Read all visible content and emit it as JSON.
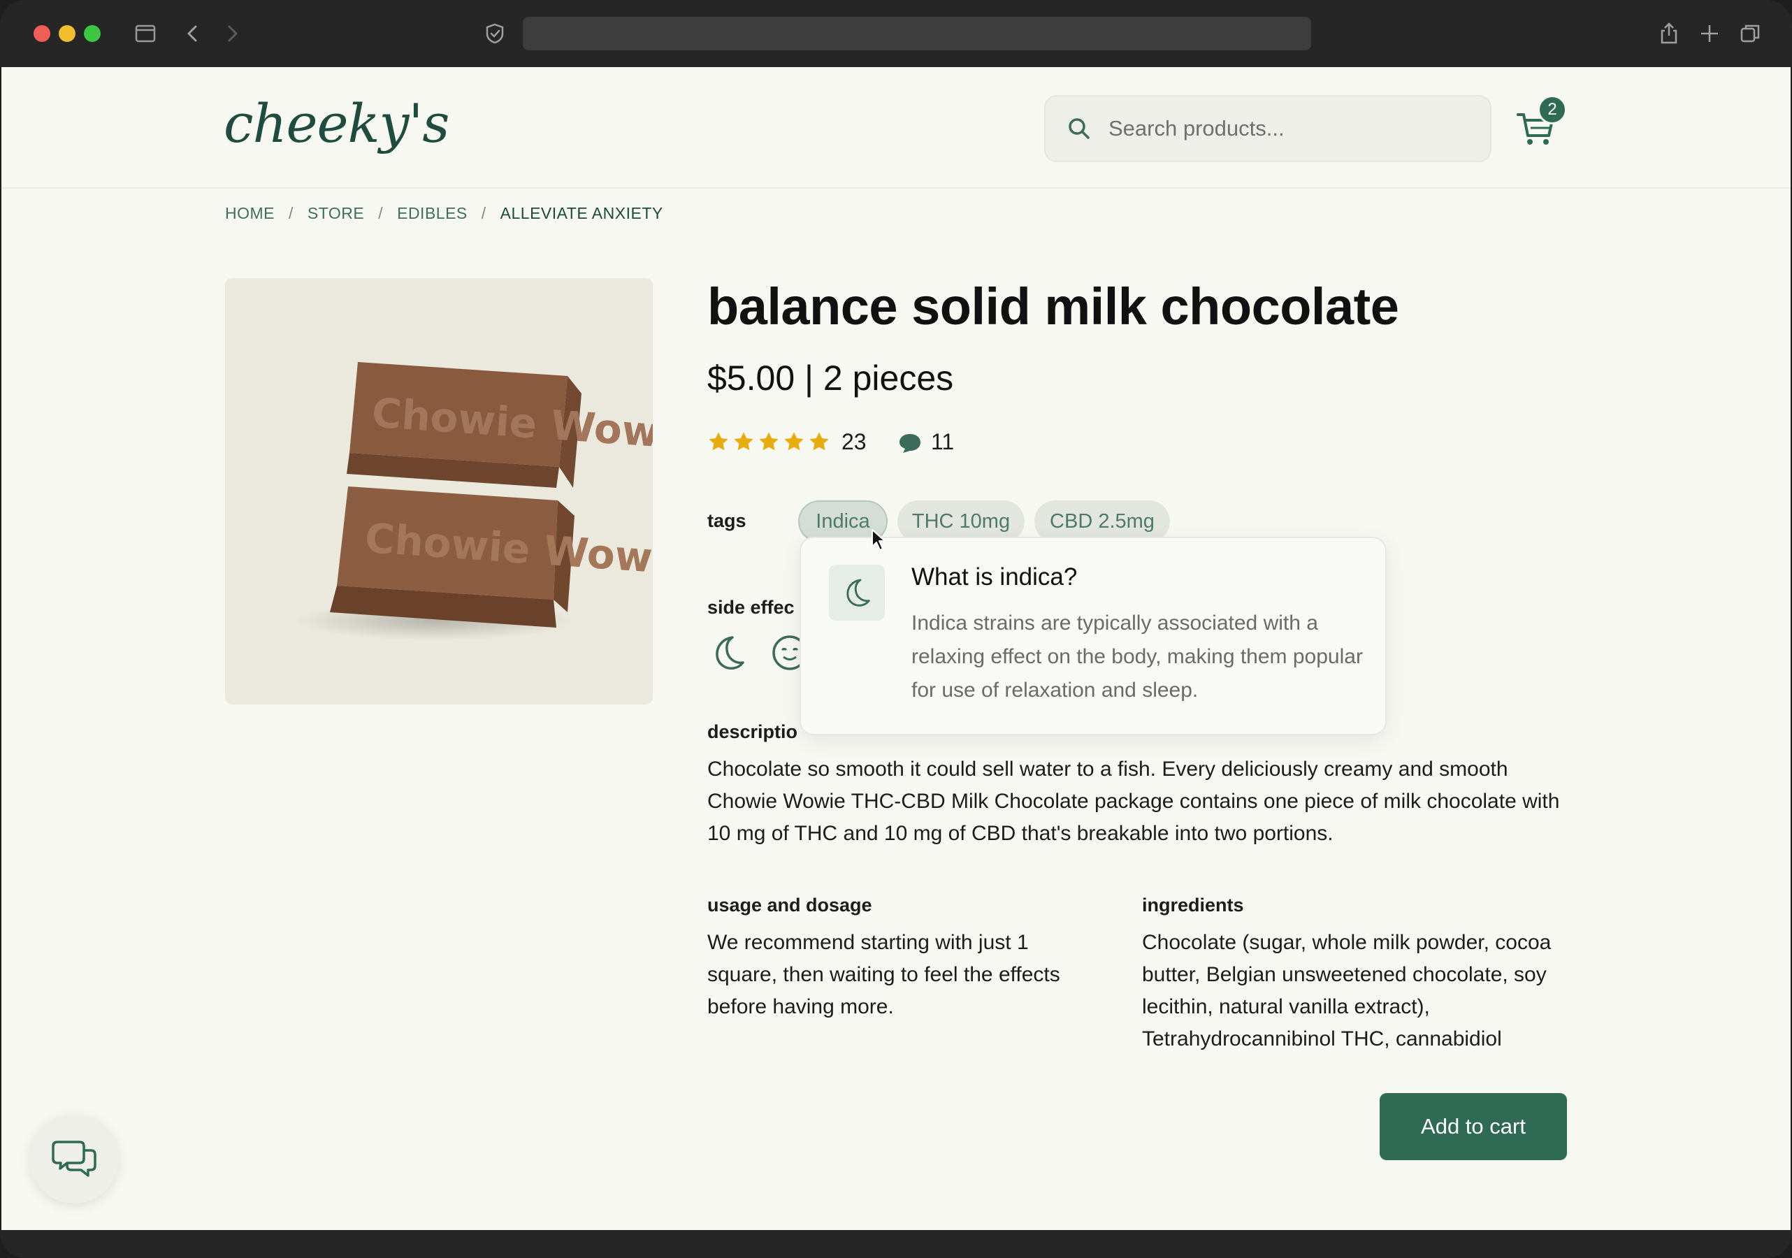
{
  "brand": {
    "logo": "cheeky's"
  },
  "search": {
    "placeholder": "Search products..."
  },
  "cart": {
    "count": "2"
  },
  "breadcrumb": {
    "items": [
      "HOME",
      "STORE",
      "EDIBLES",
      "ALLEVIATE ANXIETY"
    ],
    "separator": "/"
  },
  "product": {
    "title": "balance solid milk chocolate",
    "price": "$5.00 | 2 pieces",
    "rating": 5,
    "rating_count": "23",
    "comment_count": "11",
    "image_text": "Chowie Wowie",
    "tags_label": "tags",
    "tags": [
      "Indica",
      "THC 10mg",
      "CBD 2.5mg"
    ],
    "side_effects_label": "side effec",
    "description_label": "descriptio",
    "description": "Chocolate so smooth it could sell water to a fish. Every deliciously creamy and smooth Chowie Wowie THC-CBD Milk Chocolate package contains one piece of milk chocolate with 10 mg of THC and 10 mg of CBD that's breakable into two portions.",
    "usage_label": "usage and dosage",
    "usage": "We recommend starting with just 1 square, then waiting to feel the effects before having more.",
    "ingredients_label": "ingredients",
    "ingredients": "Chocolate (sugar, whole milk powder, cocoa butter, Belgian unsweetened chocolate, soy lecithin, natural vanilla extract), Tetrahydrocannibinol THC, cannabidiol",
    "add_to_cart": "Add to cart"
  },
  "tooltip": {
    "title": "What is indica?",
    "body": "Indica strains are typically associated with a relaxing effect on the body, making them popular for use of relaxation and sleep.",
    "icon": "moon-icon"
  },
  "colors": {
    "accent": "#2f6a55",
    "star": "#e8ac0d",
    "background": "#f8f8f3"
  }
}
